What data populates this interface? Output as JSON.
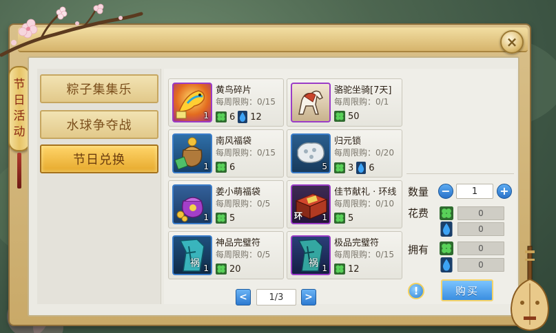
{
  "banner": {
    "chars": [
      "节",
      "日",
      "活",
      "动"
    ]
  },
  "tabs": [
    {
      "label": "粽子集集乐",
      "active": false
    },
    {
      "label": "水球争夺战",
      "active": false
    },
    {
      "label": "节日兑换",
      "active": true
    }
  ],
  "items": [
    {
      "name": "黄鸟碎片",
      "limit": "每周限购：0/15",
      "icon": "yellow-bird-fragment-icon",
      "rarity": "purple",
      "qty": "1",
      "cost": [
        {
          "type": "clover",
          "value": "6"
        },
        {
          "type": "drop",
          "value": "12"
        }
      ]
    },
    {
      "name": "骆驼坐骑[7天]",
      "limit": "每周限购：0/1",
      "icon": "camel-mount-icon",
      "rarity": "purple",
      "qty": "",
      "cost": [
        {
          "type": "clover",
          "value": "50"
        }
      ]
    },
    {
      "name": "南风福袋",
      "limit": "每周限购：0/15",
      "icon": "south-wind-lucky-bag-icon",
      "rarity": "blue",
      "qty": "1",
      "cost": [
        {
          "type": "clover",
          "value": "6"
        }
      ]
    },
    {
      "name": "归元锁",
      "limit": "每周限购：0/20",
      "icon": "guiyuan-lock-icon",
      "rarity": "blue",
      "qty": "5",
      "cost": [
        {
          "type": "clover",
          "value": "3"
        },
        {
          "type": "drop",
          "value": "6"
        }
      ]
    },
    {
      "name": "姜小萌福袋",
      "limit": "每周限购：0/5",
      "icon": "jiang-xiaomeng-lucky-bag-icon",
      "rarity": "blue",
      "qty": "1",
      "cost": [
        {
          "type": "clover",
          "value": "5"
        }
      ]
    },
    {
      "name": "佳节献礼 · 环线",
      "limit": "每周限购：0/10",
      "icon": "festival-gift-box-icon",
      "rarity": "purple",
      "qty": "1",
      "cost": [
        {
          "type": "clover",
          "value": "5"
        }
      ]
    },
    {
      "name": "神品完璧符",
      "limit": "每周限购：0/5",
      "icon": "divine-talisman-icon",
      "rarity": "blue",
      "qty": "1",
      "cost": [
        {
          "type": "clover",
          "value": "20"
        }
      ]
    },
    {
      "name": "极品完璧符",
      "limit": "每周限购：0/15",
      "icon": "supreme-talisman-icon",
      "rarity": "purple",
      "qty": "1",
      "cost": [
        {
          "type": "clover",
          "value": "12"
        }
      ]
    }
  ],
  "icon_tags": {
    "ring": "环",
    "talisman": "祸"
  },
  "pager": {
    "prev": "<",
    "next": ">",
    "page": "1/3"
  },
  "purchase": {
    "qty_label": "数量",
    "qty_value": "1",
    "minus": "−",
    "plus": "+",
    "cost_label": "花费",
    "cost_clover": "0",
    "cost_drop": "0",
    "own_label": "拥有",
    "own_clover": "0",
    "own_drop": "0",
    "help": "!",
    "buy": "购买"
  },
  "close": "×",
  "colors": {
    "clover": "#3aa83a",
    "drop": "#2f86d6",
    "active_tab": "#e6a92c",
    "button_blue": "#3a8ee0"
  }
}
